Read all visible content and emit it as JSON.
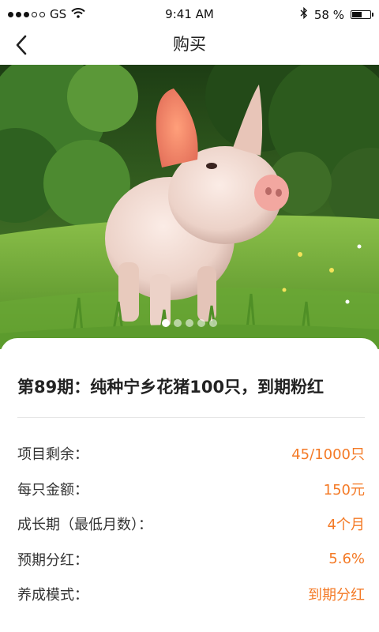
{
  "status_bar": {
    "carrier": "GS",
    "time": "9:41 AM",
    "battery_text": "58 %",
    "battery_level": 0.58,
    "signal_bars_filled": 3,
    "signal_bars_total": 5
  },
  "nav": {
    "title": "购买",
    "back_icon": "chevron-left-icon"
  },
  "carousel": {
    "total_slides": 5,
    "active_index": 0
  },
  "product": {
    "title": "第89期：纯种宁乡花猪100只，到期粉红"
  },
  "details": [
    {
      "label": "项目剩余：",
      "value": "45/1000只"
    },
    {
      "label": "每只金额：",
      "value": "150元"
    },
    {
      "label": "成长期（最低月数）：",
      "value": "4个月"
    },
    {
      "label": "预期分红：",
      "value": "5.6%"
    },
    {
      "label": "养成模式：",
      "value": "到期分红"
    }
  ],
  "colors": {
    "accent": "#f47a26",
    "text": "#222222",
    "divider": "#e6e6e6"
  }
}
